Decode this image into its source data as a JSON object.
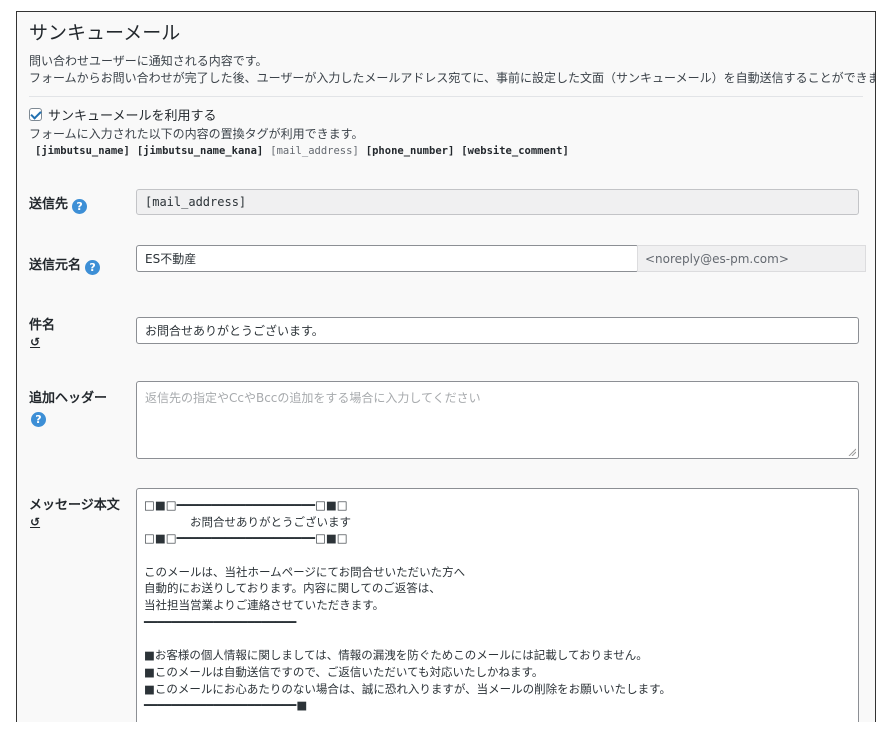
{
  "section": {
    "title": "サンキューメール",
    "desc1": "問い合わせユーザーに通知される内容です。",
    "desc2": "フォームからお問い合わせが完了した後、ユーザーが入力したメールアドレス宛てに、事前に設定した文面（サンキューメール）を自動送信することができます。"
  },
  "enable": {
    "checked": true,
    "label": "サンキューメールを利用する"
  },
  "tag_note": "フォームに入力された以下の内容の置換タグが利用できます。",
  "tags": [
    "[jimbutsu_name]",
    "[jimbutsu_name_kana]",
    "[mail_address]",
    "[phone_number]",
    "[website_comment]"
  ],
  "fields": {
    "to": {
      "label": "送信先",
      "help": "?",
      "value": "[mail_address]"
    },
    "from_name": {
      "label": "送信元名",
      "help": "?",
      "value": "ES不動産",
      "addon": "<noreply@es-pm.com>"
    },
    "subject": {
      "label": "件名",
      "reset": "↺",
      "value": "お問合せありがとうございます。"
    },
    "headers": {
      "label": "追加ヘッダー",
      "help": "?",
      "placeholder": "返信先の指定やCcやBccの追加をする場合に入力してください"
    },
    "message": {
      "label": "メッセージ本文",
      "reset": "↺",
      "lines": [
        "□■□━━━━━━━━━━━━━━━━━━━━□■□",
        "　　　　お問合せありがとうございます",
        "□■□━━━━━━━━━━━━━━━━━━━━□■□",
        "",
        "このメールは、当社ホームページにてお問合せいただいた方へ",
        "自動的にお送りしております。内容に関してのご返答は、",
        "当社担当営業よりご連絡させていただきます。",
        "━━━━━━━━━━━━━━━━━━━━━━",
        "",
        "■お客様の個人情報に関しましては、情報の漏洩を防ぐためこのメールには記載しておりません。",
        "■このメールは自動送信ですので、ご返信いただいても対応いたしかねます。",
        "■このメールにお心あたりのない場合は、誠に恐れ入りますが、当メールの削除をお願いいたします。",
        "━━━━━━━━━━━━━━━━━━━━━━■"
      ]
    }
  }
}
